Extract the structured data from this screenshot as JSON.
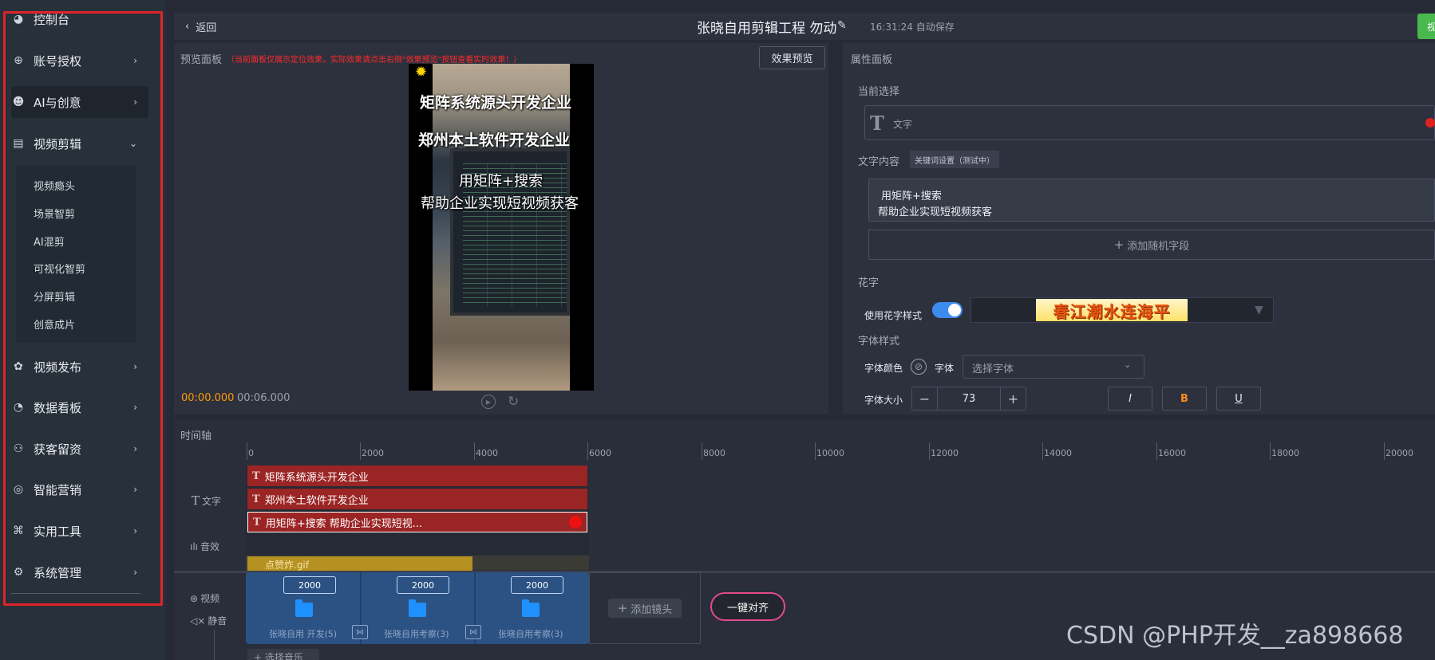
{
  "sidebar": {
    "items": [
      {
        "label": "控制台",
        "icon": "dashboard-icon",
        "chevron": ""
      },
      {
        "label": "账号授权",
        "icon": "crosshair-icon",
        "chevron": "›"
      },
      {
        "label": "AI与创意",
        "icon": "robot-icon",
        "chevron": "›"
      },
      {
        "label": "视频剪辑",
        "icon": "film-icon",
        "chevron": "⌄"
      },
      {
        "label": "视频发布",
        "icon": "publish-icon",
        "chevron": "›"
      },
      {
        "label": "数据看板",
        "icon": "pie-chart-icon",
        "chevron": "›"
      },
      {
        "label": "获客留资",
        "icon": "org-chart-icon",
        "chevron": "›"
      },
      {
        "label": "智能营销",
        "icon": "target-icon",
        "chevron": "›"
      },
      {
        "label": "实用工具",
        "icon": "command-icon",
        "chevron": "›"
      },
      {
        "label": "系统管理",
        "icon": "gear-icon",
        "chevron": "›"
      }
    ],
    "submenu": [
      "视频瘾头",
      "场景智剪",
      "AI混剪",
      "可视化智剪",
      "分屏剪辑",
      "创意成片"
    ]
  },
  "header": {
    "back_label": "返回",
    "title": "张晓自用剪辑工程 勿动",
    "autosave": "16:31:24 自动保存",
    "action_label": "视"
  },
  "preview": {
    "label": "预览面板",
    "warning": "（当前面板仅展示定位效果，实际效果请点击右侧\"效果预览\"按钮查看实时效果！）",
    "effect_button": "效果预览",
    "overlay_lines": [
      "矩阵系统源头开发企业",
      "郑州本土软件开发企业",
      "用矩阵+搜索",
      "帮助企业实现短视频获客"
    ],
    "time_current": "00:00.000",
    "time_total": "00:06.000"
  },
  "properties": {
    "title": "属性面板",
    "current_selection_label": "当前选择",
    "selection_type": "文字",
    "text_content_label": "文字内容",
    "keyword_tag": "关键词设置（测试中）",
    "content_lines": [
      "用矩阵+搜索",
      "帮助企业实现短视频获客"
    ],
    "add_random_field": "添加随机字段",
    "fancy_section": "花字",
    "use_fancy_label": "使用花字样式",
    "fancy_enabled": true,
    "fancy_sample": "春江潮水连海平",
    "font_style_section": "字体样式",
    "font_color_label": "字体颜色",
    "font_label": "字体",
    "font_placeholder": "选择字体",
    "font_size_label": "字体大小",
    "font_size": "73",
    "italic_label": "I",
    "bold_label": "B",
    "underline_label": "U"
  },
  "timeline": {
    "label": "时间轴",
    "ticks": [
      "0",
      "2000",
      "4000",
      "6000",
      "8000",
      "10000",
      "12000",
      "14000",
      "16000",
      "18000",
      "20000"
    ],
    "track_text_label": "文字",
    "track_audio_label": "音效",
    "track_video_label": "视频",
    "mute_label": "静音",
    "text_clips": [
      "矩阵系统源头开发企业",
      "郑州本土软件开发企业",
      "用矩阵+搜索 帮助企业实现短视..."
    ],
    "gif_clip": "点赞炸.gif",
    "video_clips": [
      {
        "duration": "2000",
        "name": "张晓自用 开发(5)"
      },
      {
        "duration": "2000",
        "name": "张晓自用考察(3)"
      },
      {
        "duration": "2000",
        "name": "张晓自用考察(3)"
      }
    ],
    "add_shot": "添加镜头",
    "align_button": "一键对齐",
    "select_music": "选择音乐"
  },
  "colors": {
    "accent": "#3c8cf0",
    "clip_red": "#9b2424",
    "video_blue": "#2c5283",
    "warning": "#ff2a2a",
    "time_orange": "#ff9900",
    "highlight_border": "#e0242b"
  },
  "watermark": "CSDN @PHP开发__za898668"
}
